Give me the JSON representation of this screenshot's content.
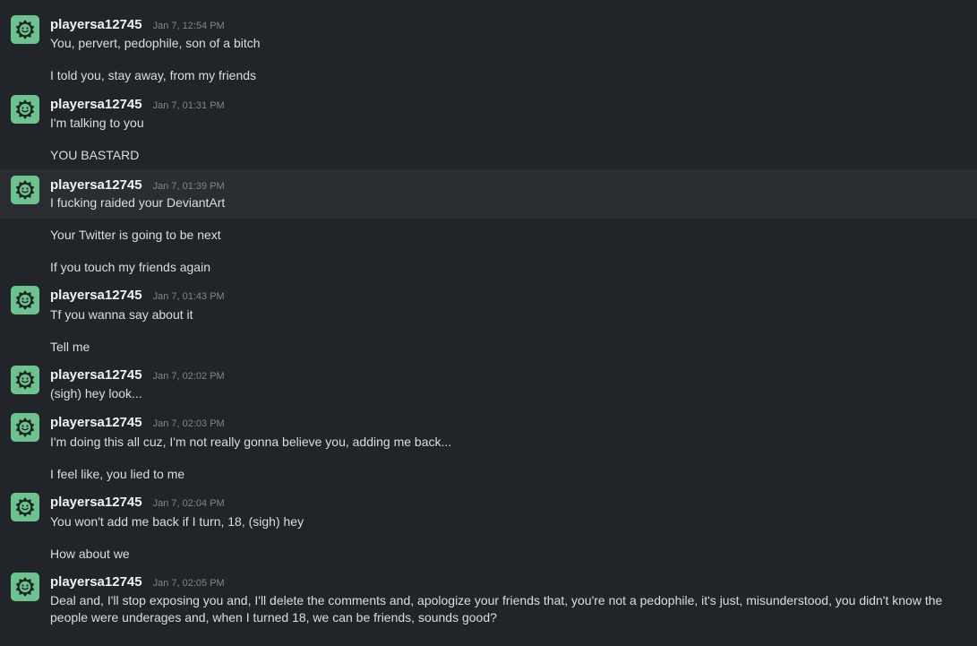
{
  "colors": {
    "background": "#212428",
    "highlight_row": "#2a2d31",
    "avatar_bg": "#6cc38e",
    "username": "#f2f3f5",
    "timestamp": "#80848e",
    "message_text": "#dcdde1"
  },
  "avatar_icon": "smiling-cog-icon",
  "messages": [
    {
      "username": "playersa12745",
      "timestamp": "Jan 7, 12:54 PM",
      "lines": [
        "You, pervert, pedophile, son of a bitch",
        "I told you, stay away, from my friends"
      ]
    },
    {
      "username": "playersa12745",
      "timestamp": "Jan 7, 01:31 PM",
      "lines": [
        "I'm talking to you",
        "YOU BASTARD"
      ]
    },
    {
      "username": "playersa12745",
      "timestamp": "Jan 7, 01:39 PM",
      "lines": [
        "I fucking raided your DeviantArt",
        "Your Twitter is going to be next",
        "If you touch my friends again"
      ]
    },
    {
      "username": "playersa12745",
      "timestamp": "Jan 7, 01:43 PM",
      "lines": [
        "Tf you wanna say about it",
        "Tell me"
      ]
    },
    {
      "username": "playersa12745",
      "timestamp": "Jan 7, 02:02 PM",
      "lines": [
        "(sigh) hey look..."
      ]
    },
    {
      "username": "playersa12745",
      "timestamp": "Jan 7, 02:03 PM",
      "lines": [
        "I'm doing this all cuz, I'm not really gonna believe you, adding me back...",
        "I feel like, you lied to me"
      ]
    },
    {
      "username": "playersa12745",
      "timestamp": "Jan 7, 02:04 PM",
      "lines": [
        "You won't add me back if I turn, 18, (sigh) hey",
        "How about we"
      ]
    },
    {
      "username": "playersa12745",
      "timestamp": "Jan 7, 02:05 PM",
      "lines": [
        "Deal and, I'll stop exposing you and, I'll delete the comments and, apologize your friends that, you're not a pedophile, it's just, misunderstood, you didn't know the people were underages and, when I turned 18, we can be friends, sounds good?"
      ]
    }
  ]
}
